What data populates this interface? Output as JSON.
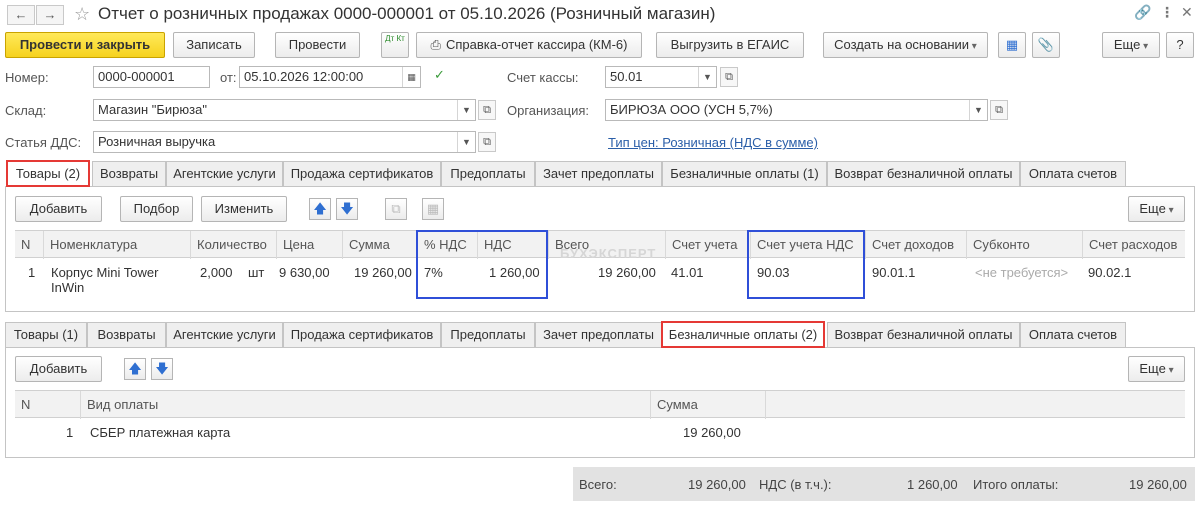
{
  "window": {
    "title": "Отчет о розничных продажах 0000-000001 от 05.10.2026 (Розничный магазин)",
    "back_icon": "arrow-left",
    "forward_icon": "arrow-right",
    "star_icon": "star",
    "link_icon": "link",
    "more_icon": "vertical-dots",
    "close_icon": "close"
  },
  "toolbar": {
    "post_close": "Провести и закрыть",
    "save": "Записать",
    "post": "Провести",
    "dt_kt": "Дт Кт",
    "cashier_report": "Справка-отчет кассира (КМ-6)",
    "egais": "Выгрузить в ЕГАИС",
    "create_based": "Создать на основании",
    "more": "Еще",
    "help": "?"
  },
  "form": {
    "number_label": "Номер:",
    "number_value": "0000-000001",
    "date_label": "от:",
    "date_value": "05.10.2026 12:00:00",
    "cash_account_label": "Счет кассы:",
    "cash_account_value": "50.01",
    "warehouse_label": "Склад:",
    "warehouse_value": "Магазин \"Бирюза\"",
    "organization_label": "Организация:",
    "organization_value": "БИРЮЗА ООО (УСН 5,7%)",
    "dds_label": "Статья ДДС:",
    "dds_value": "Розничная выручка",
    "price_type_link": "Тип цен: Розничная (НДС в сумме)"
  },
  "tabs_top": [
    "Товары (2)",
    "Возвраты",
    "Агентские услуги",
    "Продажа сертификатов",
    "Предоплаты",
    "Зачет предоплаты",
    "Безналичные оплаты (1)",
    "Возврат безналичной оплаты",
    "Оплата счетов"
  ],
  "tabs_bottom": [
    "Товары (1)",
    "Возвраты",
    "Агентские услуги",
    "Продажа сертификатов",
    "Предоплаты",
    "Зачет предоплаты",
    "Безналичные оплаты (2)",
    "Возврат безналичной оплаты",
    "Оплата счетов"
  ],
  "goods": {
    "add": "Добавить",
    "select": "Подбор",
    "change": "Изменить",
    "more": "Еще",
    "columns": [
      "N",
      "Номенклатура",
      "Количество",
      "Цена",
      "Сумма",
      "% НДС",
      "НДС",
      "Всего",
      "Счет учета",
      "Счет учета НДС",
      "Счет доходов",
      "Субконто",
      "Счет расходов"
    ],
    "row": {
      "n": "1",
      "name_line1": "Корпус Mini Tower",
      "name_line2": "InWin",
      "qty": "2,000",
      "unit": "шт",
      "price": "9 630,00",
      "sum": "19 260,00",
      "vat_rate": "7%",
      "vat": "1 260,00",
      "total": "19 260,00",
      "account": "41.01",
      "vat_account": "90.03",
      "income_account": "90.01.1",
      "subconto": "<не требуется>",
      "expense_account": "90.02.1"
    }
  },
  "watermark": "БУХЭКСПЕРТ",
  "payments": {
    "add": "Добавить",
    "more": "Еще",
    "columns": [
      "N",
      "Вид оплаты",
      "Сумма"
    ],
    "row": {
      "n": "1",
      "type": "СБЕР платежная карта",
      "sum": "19 260,00"
    }
  },
  "footer": {
    "total_label": "Всего:",
    "total_value": "19 260,00",
    "vat_label": "НДС (в т.ч.):",
    "vat_value": "1 260,00",
    "paid_label": "Итого оплаты:",
    "paid_value": "19 260,00"
  },
  "colors": {
    "primary_button": "#f6d21e",
    "highlight_red": "#e53935",
    "highlight_blue": "#2f4fd8",
    "link": "#2a5ea8"
  }
}
